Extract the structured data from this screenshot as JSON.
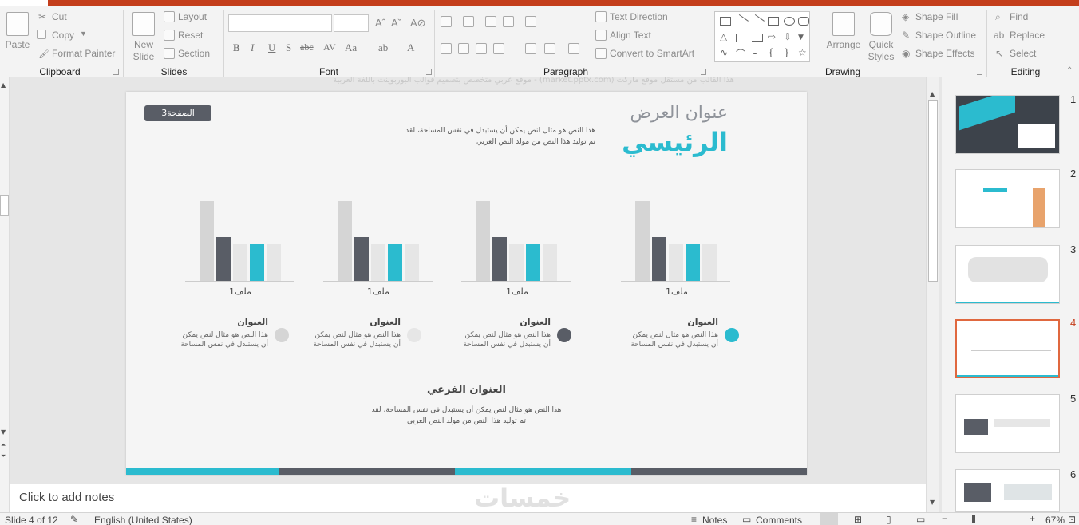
{
  "ribbon": {
    "clipboard": {
      "paste": "Paste",
      "cut": "Cut",
      "copy": "Copy",
      "format_painter": "Format Painter",
      "label": "Clipboard"
    },
    "slides": {
      "new_slide": "New",
      "new_slide_2": "Slide",
      "layout": "Layout",
      "reset": "Reset",
      "section": "Section",
      "label": "Slides"
    },
    "font": {
      "bold": "B",
      "italic": "I",
      "underline": "U",
      "shadow": "S",
      "strike": "abc",
      "spacing": "AV",
      "case": "Aa",
      "color": "A",
      "label": "Font"
    },
    "paragraph": {
      "text_direction": "Text Direction",
      "align_text": "Align Text",
      "smartart": "Convert to SmartArt",
      "label": "Paragraph"
    },
    "drawing": {
      "arrange": "Arrange",
      "quick_styles": "Quick",
      "quick_styles_2": "Styles",
      "shape_fill": "Shape Fill",
      "shape_outline": "Shape Outline",
      "shape_effects": "Shape Effects",
      "label": "Drawing"
    },
    "editing": {
      "find": "Find",
      "replace": "Replace",
      "select": "Select",
      "label": "Editing"
    }
  },
  "ghost_text": "هذا القالب من مستقل موقع ماركت (market.pptx.com) - موقع عربي متخصص بتصميم قوالب البوربوينت باللغة العربية",
  "slide": {
    "page_badge": "الصفحة3",
    "title_line1": "عنوان العرض",
    "title_line2": "الرئيسي",
    "intro": [
      "هذا النص هو مثال لنص يمكن أن يستبدل في نفس المساحة، لقد",
      "تم توليد هذا النص من مولد النص العربي"
    ],
    "charts": [
      {
        "label": "ملف1",
        "values": [
          100,
          55,
          46,
          46,
          46
        ]
      },
      {
        "label": "ملف1",
        "values": [
          100,
          55,
          46,
          46,
          46
        ]
      },
      {
        "label": "ملف1",
        "values": [
          100,
          55,
          46,
          46,
          46
        ]
      },
      {
        "label": "ملف1",
        "values": [
          100,
          55,
          46,
          46,
          46
        ]
      }
    ],
    "items": [
      {
        "title": "العنوان",
        "text1": "هذا النص هو مثال لنص يمكن",
        "text2": "أن يستبدل في نفس المساحة",
        "color": "#2bbbcf"
      },
      {
        "title": "العنوان",
        "text1": "هذا النص هو مثال لنص يمكن",
        "text2": "أن يستبدل في نفس المساحة",
        "color": "#595d66"
      },
      {
        "title": "العنوان",
        "text1": "هذا النص هو مثال لنص يمكن",
        "text2": "أن يستبدل في نفس المساحة",
        "color": "#e6e6e6"
      },
      {
        "title": "العنوان",
        "text1": "هذا النص هو مثال لنص يمكن",
        "text2": "أن يستبدل في نفس المساحة",
        "color": "#d5d5d5"
      }
    ],
    "subtitle": "العنوان الفرعي",
    "sub_text": [
      "هذا النص هو مثال لنص يمكن أن يستبدل في نفس المساحة، لقد",
      "تم توليد هذا النص من مولد النص العربي"
    ],
    "colors": {
      "teal": "#2bbbcf",
      "dark": "#595d66",
      "light": "#d5d5d5",
      "lighter": "#e6e6e6"
    }
  },
  "thumbnails": [
    "1",
    "2",
    "3",
    "4",
    "5",
    "6"
  ],
  "active_thumbnail": 4,
  "notes_placeholder": "Click to add notes",
  "watermark": "خمسات",
  "status": {
    "slide_info": "Slide 4 of 12",
    "language": "English (United States)",
    "notes": "Notes",
    "comments": "Comments",
    "zoom": "67%"
  }
}
